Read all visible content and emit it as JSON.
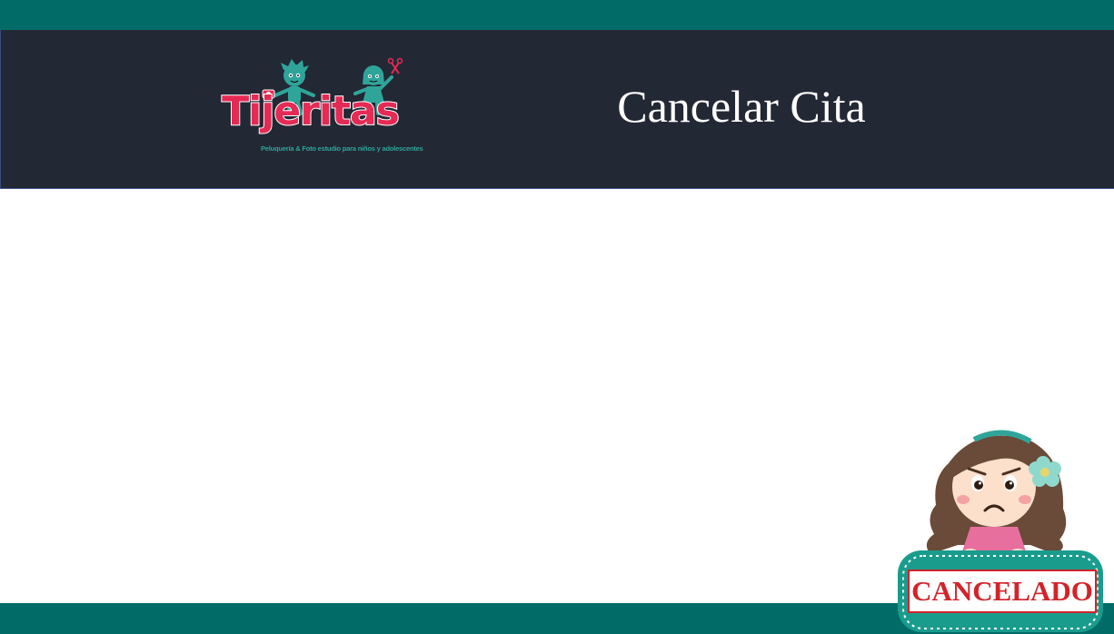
{
  "brand": {
    "name": "Tijeritas",
    "tagline": "Peluquería & Foto estudio para niños y adolescentes"
  },
  "header": {
    "title": "Cancelar Cita"
  },
  "illustration": {
    "stamp_text": "CANCELADO"
  },
  "colors": {
    "teal_bar": "#006b67",
    "header_bg": "#222834",
    "brand_pink": "#e52a54",
    "brand_teal": "#2fa59a",
    "stamp_red": "#d3232a"
  }
}
